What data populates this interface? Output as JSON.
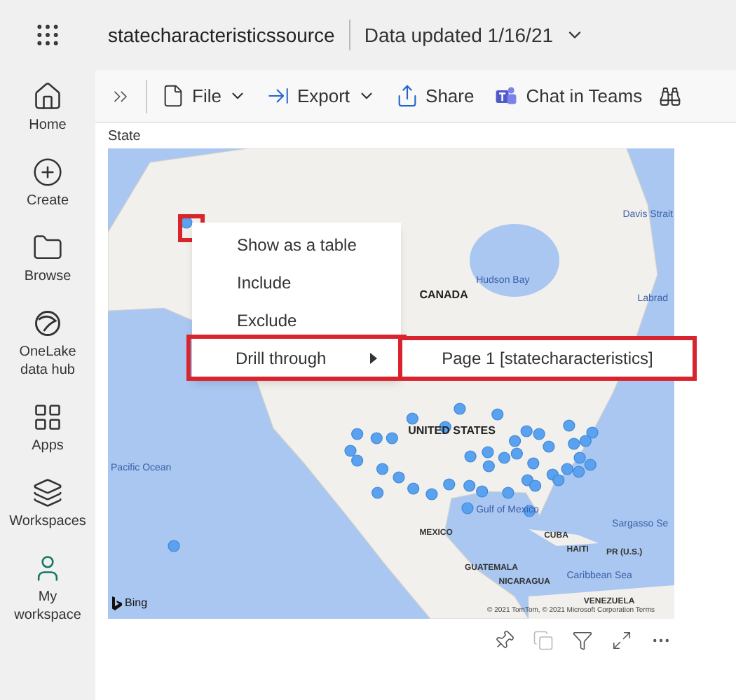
{
  "header": {
    "title": "statecharacteristicssource",
    "data_updated": "Data updated 1/16/21"
  },
  "sidebar": {
    "items": [
      {
        "label": "Home",
        "selected": false
      },
      {
        "label": "Create",
        "selected": false
      },
      {
        "label": "Browse",
        "selected": false
      },
      {
        "label": "OneLake data hub",
        "selected": false
      },
      {
        "label": "Apps",
        "selected": false
      },
      {
        "label": "Workspaces",
        "selected": false
      },
      {
        "label": "My workspace",
        "selected": true
      }
    ]
  },
  "toolbar": {
    "items": [
      {
        "label": "File",
        "dropdown": true
      },
      {
        "label": "Export",
        "dropdown": true
      },
      {
        "label": "Share",
        "dropdown": false
      },
      {
        "label": "Chat in Teams",
        "dropdown": false
      }
    ]
  },
  "visual": {
    "title": "State",
    "map_labels": [
      {
        "text": "Davis Strait",
        "kind": "water"
      },
      {
        "text": "Hudson Bay",
        "kind": "water"
      },
      {
        "text": "CANADA",
        "kind": "country"
      },
      {
        "text": "Labrad",
        "kind": "water"
      },
      {
        "text": "UNITED STATES",
        "kind": "country"
      },
      {
        "text": "Pacific Ocean",
        "kind": "water"
      },
      {
        "text": "Gulf of Mexico",
        "kind": "water"
      },
      {
        "text": "Sargasso Se",
        "kind": "water"
      },
      {
        "text": "MEXICO",
        "kind": "small"
      },
      {
        "text": "CUBA",
        "kind": "small"
      },
      {
        "text": "HAITI",
        "kind": "small"
      },
      {
        "text": "PR (U.S.)",
        "kind": "small"
      },
      {
        "text": "GUATEMALA",
        "kind": "small"
      },
      {
        "text": "Caribbean Sea",
        "kind": "water"
      },
      {
        "text": "NICARAGUA",
        "kind": "small"
      },
      {
        "text": "VENEZUELA",
        "kind": "small"
      }
    ],
    "attribution": "© 2021 TomTom, © 2021 Microsoft Corporation  Terms",
    "bing": "Bing",
    "context_menu": [
      {
        "label": "Show as a table",
        "submenu": false,
        "highlighted": false
      },
      {
        "label": "Include",
        "submenu": false,
        "highlighted": false
      },
      {
        "label": "Exclude",
        "submenu": false,
        "highlighted": false
      },
      {
        "label": "Drill through",
        "submenu": true,
        "highlighted": true
      }
    ],
    "submenu": [
      {
        "label": "Page 1 [statecharacteristics]",
        "highlighted": true
      }
    ]
  }
}
